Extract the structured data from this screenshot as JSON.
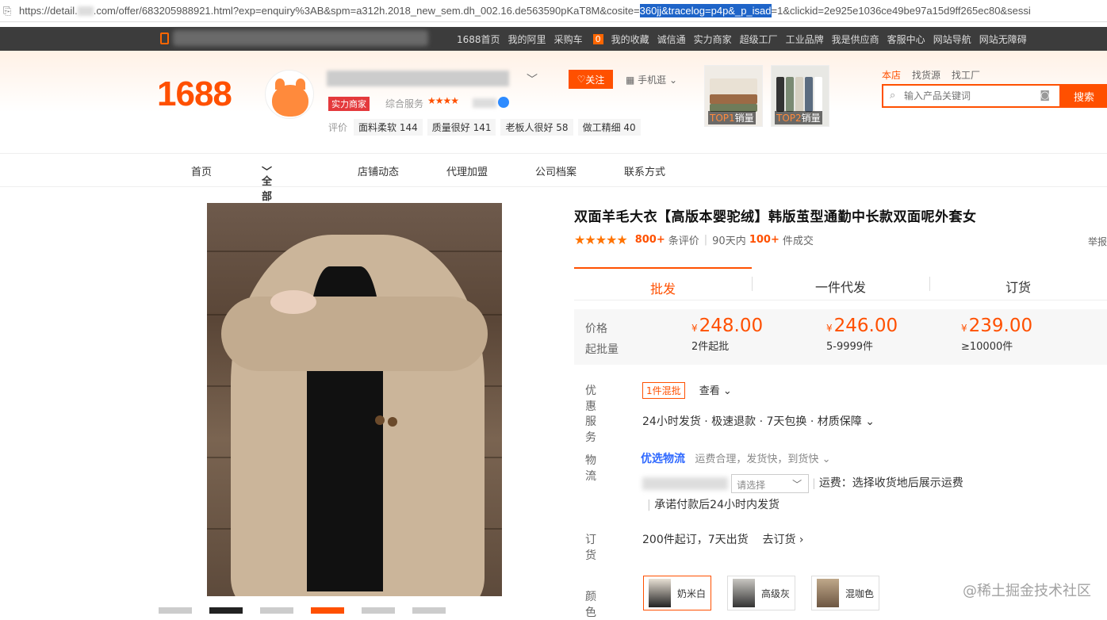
{
  "address_bar": {
    "pre": "https://detail.",
    "mid": ".com/offer/683205988921.html?exp=enquiry%3AB&spm=a312h.2018_new_sem.dh_002.16.de563590pKaT8M&cosite=",
    "selected": "360jj&tracelog=p4p&_p_isad",
    "post": "=1&clickid=2e925e1036ce49be97a15d9ff265ec80&sessi"
  },
  "topbar": {
    "links": [
      "1688首页",
      "我的阿里",
      "采购车",
      "我的收藏",
      "诚信通",
      "实力商家",
      "超级工厂",
      "工业品牌",
      "我是供应商",
      "客服中心",
      "网站导航",
      "网站无障碍"
    ],
    "cart_count": "0"
  },
  "header": {
    "logo": "1688",
    "badge": "实力商家",
    "service": "综合服务",
    "stars": "★★★★",
    "follow": "关注",
    "mobile": "手机逛",
    "review_label": "评价",
    "tags": [
      "面料柔软 144",
      "质量很好 141",
      "老板人很好 58",
      "做工精细 40"
    ],
    "top_items": [
      {
        "rank": "TOP1",
        "label": "销量"
      },
      {
        "rank": "TOP2",
        "label": "销量"
      }
    ],
    "search_tabs": [
      "本店",
      "找货源",
      "找工厂"
    ],
    "search_placeholder": "输入产品关键词",
    "search_button": "搜索"
  },
  "nav": [
    "首页",
    "全部商品",
    "店铺动态",
    "代理加盟",
    "公司档案",
    "联系方式"
  ],
  "product": {
    "title": "双面羊毛大衣【高版本婴驼绒】韩版茧型通勤中长款双面呢外套女",
    "stars": "★★★★★",
    "reviews": "800+",
    "reviews_label": "条评价",
    "days": "90天内",
    "sold": "100+",
    "sold_label": "件成交",
    "report": "举报"
  },
  "tabs": [
    "批发",
    "一件代发",
    "订货"
  ],
  "price": {
    "label_price": "价格",
    "label_moq": "起批量",
    "currency": "¥",
    "tiers": [
      {
        "price": "248.00",
        "qty": "2件起批"
      },
      {
        "price": "246.00",
        "qty": "5-9999件"
      },
      {
        "price": "239.00",
        "qty": "≥10000件"
      }
    ]
  },
  "details": {
    "promo_k": "优惠",
    "promo_badge": "1件混批",
    "promo_view": "查看",
    "service_k": "服务",
    "service_v": "24小时发货 · 极速退款 · 7天包换 · 材质保障",
    "logistics_k": "物流",
    "logistics_brand": "优选物流",
    "logistics_desc": "运费合理，发货快，到货快",
    "select_placeholder": "请选择",
    "freight": "运费：选择收货地后展示运费",
    "ship_promise": "承诺付款后24小时内发货",
    "order_k": "订货",
    "order_v": "200件起订，7天出货",
    "order_link": "去订货",
    "color_k": "颜色",
    "colors": [
      "奶米白",
      "高级灰",
      "混咖色"
    ]
  },
  "watermark": "@稀土掘金技术社区"
}
